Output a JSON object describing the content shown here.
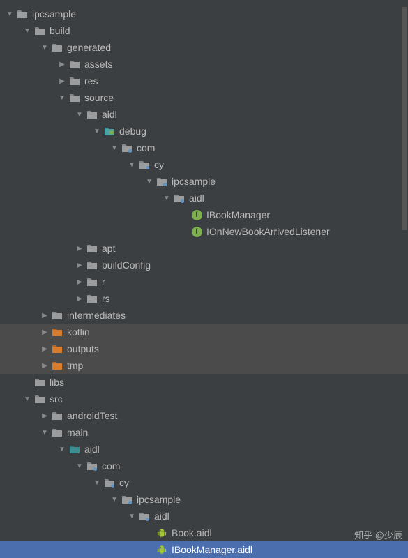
{
  "watermark": "知乎 @少辰",
  "nodes": [
    {
      "indent": 0,
      "arrow": "down",
      "icon": "folder-module",
      "label": "ipcsample",
      "interactable": true
    },
    {
      "indent": 1,
      "arrow": "down",
      "icon": "folder-gray",
      "label": "build",
      "interactable": true
    },
    {
      "indent": 2,
      "arrow": "down",
      "icon": "folder-gray",
      "label": "generated",
      "interactable": true
    },
    {
      "indent": 3,
      "arrow": "right",
      "icon": "folder-gray",
      "label": "assets",
      "interactable": true
    },
    {
      "indent": 3,
      "arrow": "right",
      "icon": "folder-gray",
      "label": "res",
      "interactable": true
    },
    {
      "indent": 3,
      "arrow": "down",
      "icon": "folder-gray",
      "label": "source",
      "interactable": true
    },
    {
      "indent": 4,
      "arrow": "down",
      "icon": "folder-gray",
      "label": "aidl",
      "interactable": true
    },
    {
      "indent": 5,
      "arrow": "down",
      "icon": "folder-debug",
      "label": "debug",
      "interactable": true
    },
    {
      "indent": 6,
      "arrow": "down",
      "icon": "folder-pkg",
      "label": "com",
      "interactable": true
    },
    {
      "indent": 7,
      "arrow": "down",
      "icon": "folder-pkg",
      "label": "cy",
      "interactable": true
    },
    {
      "indent": 8,
      "arrow": "down",
      "icon": "folder-pkg",
      "label": "ipcsample",
      "interactable": true
    },
    {
      "indent": 9,
      "arrow": "down",
      "icon": "folder-pkg",
      "label": "aidl",
      "interactable": true
    },
    {
      "indent": 10,
      "arrow": "none",
      "icon": "interface",
      "label": "IBookManager",
      "interactable": true
    },
    {
      "indent": 10,
      "arrow": "none",
      "icon": "interface",
      "label": "IOnNewBookArrivedListener",
      "interactable": true
    },
    {
      "indent": 4,
      "arrow": "right",
      "icon": "folder-gray",
      "label": "apt",
      "interactable": true
    },
    {
      "indent": 4,
      "arrow": "right",
      "icon": "folder-gray",
      "label": "buildConfig",
      "interactable": true
    },
    {
      "indent": 4,
      "arrow": "right",
      "icon": "folder-gray",
      "label": "r",
      "interactable": true
    },
    {
      "indent": 4,
      "arrow": "right",
      "icon": "folder-gray",
      "label": "rs",
      "interactable": true
    },
    {
      "indent": 2,
      "arrow": "right",
      "icon": "folder-gray",
      "label": "intermediates",
      "interactable": true
    },
    {
      "indent": 2,
      "arrow": "right",
      "icon": "folder-orange",
      "label": "kotlin",
      "interactable": true,
      "highlight": true
    },
    {
      "indent": 2,
      "arrow": "right",
      "icon": "folder-orange",
      "label": "outputs",
      "interactable": true,
      "highlight": true
    },
    {
      "indent": 2,
      "arrow": "right",
      "icon": "folder-orange",
      "label": "tmp",
      "interactable": true,
      "highlight": true
    },
    {
      "indent": 1,
      "arrow": "none",
      "icon": "folder-gray",
      "label": "libs",
      "interactable": true
    },
    {
      "indent": 1,
      "arrow": "down",
      "icon": "folder-gray",
      "label": "src",
      "interactable": true
    },
    {
      "indent": 2,
      "arrow": "right",
      "icon": "folder-gray",
      "label": "androidTest",
      "interactable": true
    },
    {
      "indent": 2,
      "arrow": "down",
      "icon": "folder-gray",
      "label": "main",
      "interactable": true
    },
    {
      "indent": 3,
      "arrow": "down",
      "icon": "folder-teal",
      "label": "aidl",
      "interactable": true
    },
    {
      "indent": 4,
      "arrow": "down",
      "icon": "folder-pkg",
      "label": "com",
      "interactable": true
    },
    {
      "indent": 5,
      "arrow": "down",
      "icon": "folder-pkg",
      "label": "cy",
      "interactable": true
    },
    {
      "indent": 6,
      "arrow": "down",
      "icon": "folder-pkg",
      "label": "ipcsample",
      "interactable": true
    },
    {
      "indent": 7,
      "arrow": "down",
      "icon": "folder-pkg",
      "label": "aidl",
      "interactable": true
    },
    {
      "indent": 8,
      "arrow": "none",
      "icon": "android",
      "label": "Book.aidl",
      "interactable": true
    },
    {
      "indent": 8,
      "arrow": "none",
      "icon": "android",
      "label": "IBookManager.aidl",
      "interactable": true,
      "selected": true
    }
  ]
}
